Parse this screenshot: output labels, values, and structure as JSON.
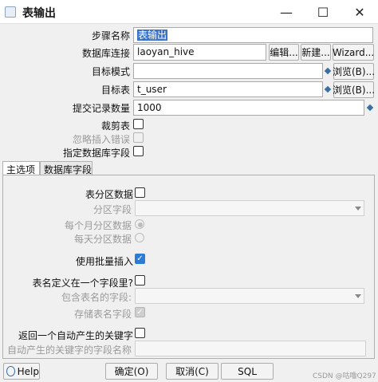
{
  "window": {
    "title": "表输出",
    "minimize_glyph": "—",
    "maximize_glyph": "☐",
    "close_glyph": "✕"
  },
  "form": {
    "step_name_label": "步骤名称",
    "step_name_value": "表输出",
    "db_connection_label": "数据库连接",
    "db_connection_value": "laoyan_hive",
    "edit_button": "编辑...",
    "new_button": "新建...",
    "wizard_button": "Wizard...",
    "target_schema_label": "目标模式",
    "target_schema_value": "",
    "browse_schema_button": "浏览(B)...",
    "target_table_label": "目标表",
    "target_table_value": "t_user",
    "browse_table_button": "浏览(B)...",
    "commit_size_label": "提交记录数量",
    "commit_size_value": "1000",
    "truncate_label": "裁剪表",
    "ignore_errors_label": "忽略插入错误",
    "specify_fields_label": "指定数据库字段"
  },
  "tabs": [
    {
      "label": "主选项"
    },
    {
      "label": "数据库字段"
    }
  ],
  "main_options": {
    "partition_label": "表分区数据",
    "partition_field_label": "分区字段",
    "partition_monthly_label": "每个月分区数据",
    "partition_daily_label": "每天分区数据",
    "batch_insert_label": "使用批量插入",
    "table_in_field_label": "表名定义在一个字段里?",
    "table_name_field_label": "包含表名的字段:",
    "store_table_name_label": "存储表名字段",
    "return_key_label": "返回一个自动产生的关键字",
    "key_field_name_label": "自动产生的关键字的字段名称"
  },
  "footer": {
    "help_button": "Help",
    "ok_button": "确定(O)",
    "cancel_button": "取消(C)",
    "sql_button": "SQL",
    "watermark": "CSDN @咕噜Q297"
  },
  "colors": {
    "accent": "#2e7bd6",
    "selection": "#3a74c9",
    "variable_diamond": "#3a6ea5"
  }
}
